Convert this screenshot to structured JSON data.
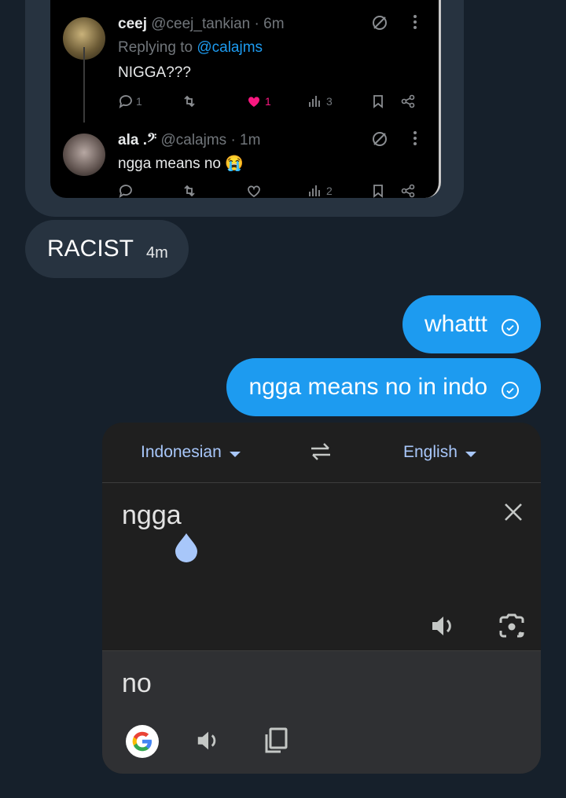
{
  "attachment": {
    "tweets": [
      {
        "name": "ceej",
        "handle": "@ceej_tankian",
        "time": "· 6m",
        "replying_prefix": "Replying to",
        "replying_to": "@calajms",
        "text": "NIGGA???",
        "replies": "1",
        "likes": "1",
        "views": "3"
      },
      {
        "name": "ala .𝄢",
        "handle": "@calajms",
        "time": "· 1m",
        "text": "ngga means no 😭",
        "views": "2"
      }
    ]
  },
  "messages": {
    "received": {
      "text": "RACIST",
      "time": "4m"
    },
    "sent": [
      {
        "text": "whattt"
      },
      {
        "text": "ngga means no in indo"
      }
    ]
  },
  "translate": {
    "source_lang": "Indonesian",
    "target_lang": "English",
    "source_text": "ngga",
    "output_text": "no",
    "colors": {
      "accent": "#a8c7fa",
      "card": "#1f1f1f",
      "output_bg": "#2f3033"
    }
  },
  "colors": {
    "background": "#16202b",
    "bubble_received": "#273340",
    "bubble_sent": "#1d9bf0"
  }
}
